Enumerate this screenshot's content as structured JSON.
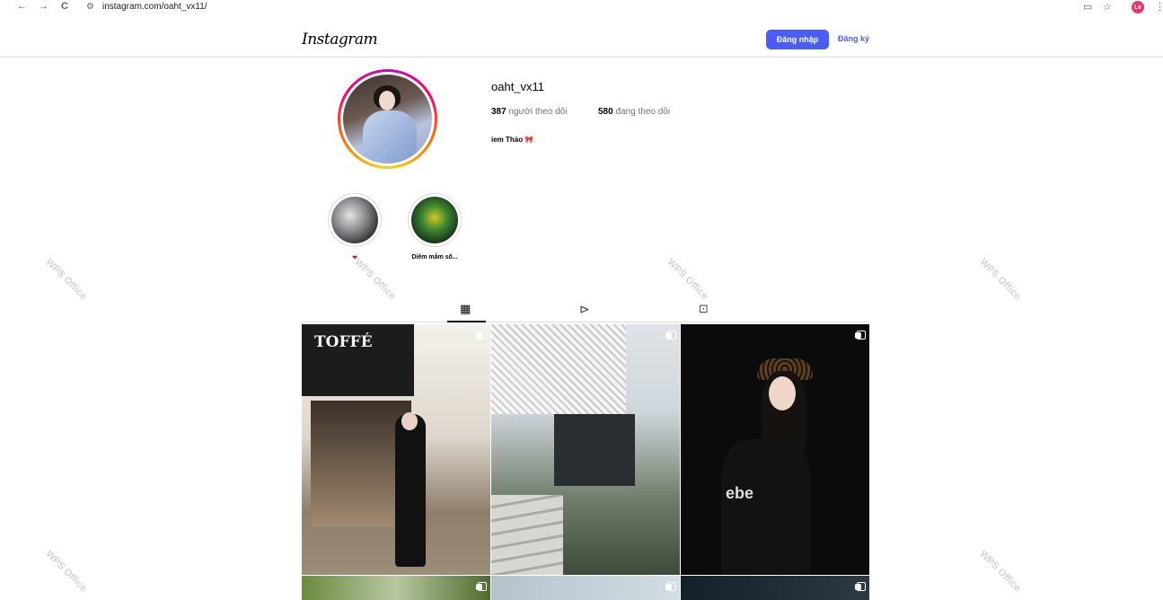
{
  "browser": {
    "url": "instagram.com/oaht_vx11/",
    "back": "←",
    "forward": "→",
    "reload": "C",
    "profile_initials": "Le"
  },
  "header": {
    "logo": "Instagram",
    "login_label": "Đăng nhập",
    "signup_label": "Đăng ký"
  },
  "profile": {
    "username": "oaht_vx11",
    "followers_count": "387",
    "followers_label": "người theo dõi",
    "following_count": "580",
    "following_label": "đang theo dõi",
    "bio": "iem Thảo 🎀"
  },
  "highlights": [
    {
      "label": "❤"
    },
    {
      "label": "Diêm mắm số..."
    }
  ],
  "tabs": [
    "posts-grid",
    "reels",
    "tagged"
  ],
  "watermark": "WPS Office",
  "colors": {
    "accent": "#4a5df9",
    "border": "#dbdbdb",
    "secondary_text": "#737373"
  }
}
